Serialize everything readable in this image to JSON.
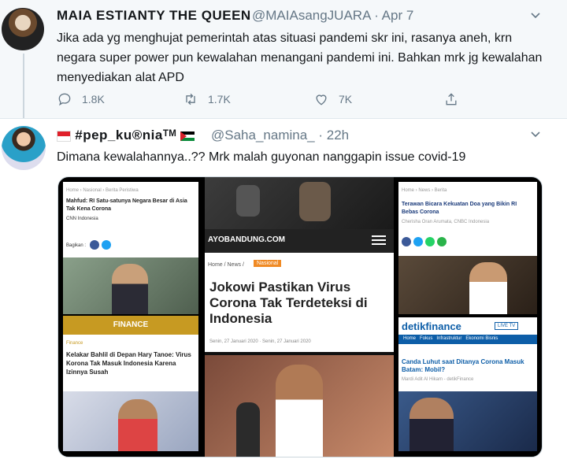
{
  "tweet1": {
    "display_name": "MAIA ESTIANTY THE QUEEN",
    "handle_date": "@MAIAsangJUARA · Apr 7",
    "text": "Jika ada yg menghujat pemerintah atas situasi pandemi skr ini, rasanya aneh, krn negara super power pun kewalahan menangani pandemi ini. Bahkan mrk jg kewalahan menyediakan alat APD",
    "replies": "1.8K",
    "retweets": "1.7K",
    "likes": "7K"
  },
  "tweet2": {
    "display_name": "#pep_ku®niaᵀᴹ",
    "handle_date": "@Saha_namina_ · 22h",
    "text": "Dimana kewalahannya..?? Mrk malah guyonan nanggapin issue covid-19"
  },
  "media": {
    "cnn": {
      "breadcrumb": "Home › Nasional › Berita Peristiwa",
      "headline": "Mahfud: RI Satu-satunya Negara Besar di Asia Tak Kena Corona",
      "source": "CNN Indonesia",
      "share": "Bagikan :"
    },
    "finance": {
      "bar": "FINANCE",
      "tag": "Finance",
      "headline": "Kelakar Bahlil di Depan Hary Tanoe: Virus Korona Tak Masuk Indonesia Karena Izinnya Susah"
    },
    "ayo": {
      "logo": "AYOBANDUNG.COM",
      "breadcrumb": "Home / News /",
      "tag": "Nasional",
      "headline": "Jokowi Pastikan Virus Corona Tak Terdeteksi di Indonesia",
      "dates": "Senin, 27 Januari 2020  ·  Senin, 27 Januari 2020"
    },
    "terawan": {
      "breadcrumb": "Home › News › Berita",
      "headline": "Terawan Bicara Kekuatan Doa yang Bikin RI Bebas Corona",
      "source": "Cherisha Oran Arumata, CNBC Indonesia"
    },
    "detik": {
      "logo": "detikfinance",
      "live": "LIVE TV",
      "nav": "Home   Fokus   Infrastruktur   Ekonomi Bisnis",
      "headline": "Canda Luhut saat Ditanya Corona Masuk Batam: Mobil?",
      "author": "Mardi Adit Al Hikam - detikFinance"
    }
  },
  "colors": {
    "accent": "#1da1f2",
    "muted": "#657786",
    "finance_gold": "#c79a22",
    "ayo_orange": "#f08a24",
    "detik_blue": "#0d5ea8"
  }
}
